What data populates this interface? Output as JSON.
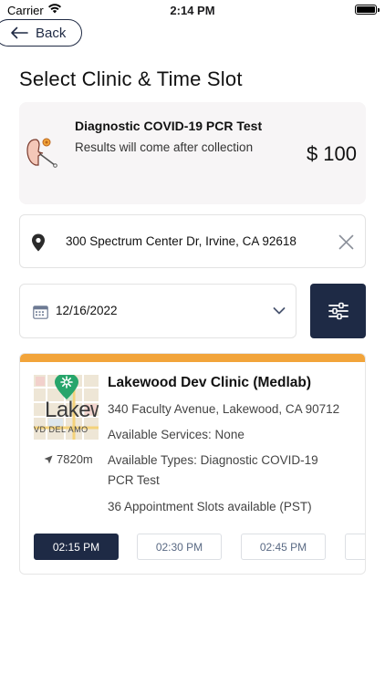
{
  "status_bar": {
    "carrier": "Carrier",
    "time": "2:14 PM"
  },
  "header": {
    "back_label": "Back",
    "title": "Select Clinic & Time Slot"
  },
  "test": {
    "name": "Diagnostic COVID-19 PCR Test",
    "subtitle": "Results will come after collection",
    "price": "$ 100",
    "icon": "covid-test-icon"
  },
  "location": {
    "address": "300 Spectrum Center Dr, Irvine, CA 92618",
    "icon": "map-pin-icon",
    "clear_icon": "close-icon"
  },
  "date_picker": {
    "value": "12/16/2022",
    "icon": "calendar-icon"
  },
  "filter": {
    "icon": "sliders-icon"
  },
  "clinic": {
    "name": "Lakewood Dev Clinic (Medlab)",
    "address": "340 Faculty Avenue, Lakewood, CA 90712",
    "services": "Available Services: None",
    "types": "Available Types: Diagnostic COVID-19 PCR Test",
    "slots_available": "36 Appointment Slots available (PST)",
    "distance": "7820m",
    "map_label": "Lakew",
    "map_street": "VD   DEL AMO",
    "accent_color": "#f2a43a"
  },
  "time_slots": [
    {
      "label": "02:15 PM",
      "selected": true
    },
    {
      "label": "02:30 PM",
      "selected": false
    },
    {
      "label": "02:45 PM",
      "selected": false
    },
    {
      "label": "",
      "selected": false
    }
  ],
  "colors": {
    "primary": "#1e2a45",
    "accent": "#f2a43a",
    "card_bg": "#f7f5f6"
  }
}
